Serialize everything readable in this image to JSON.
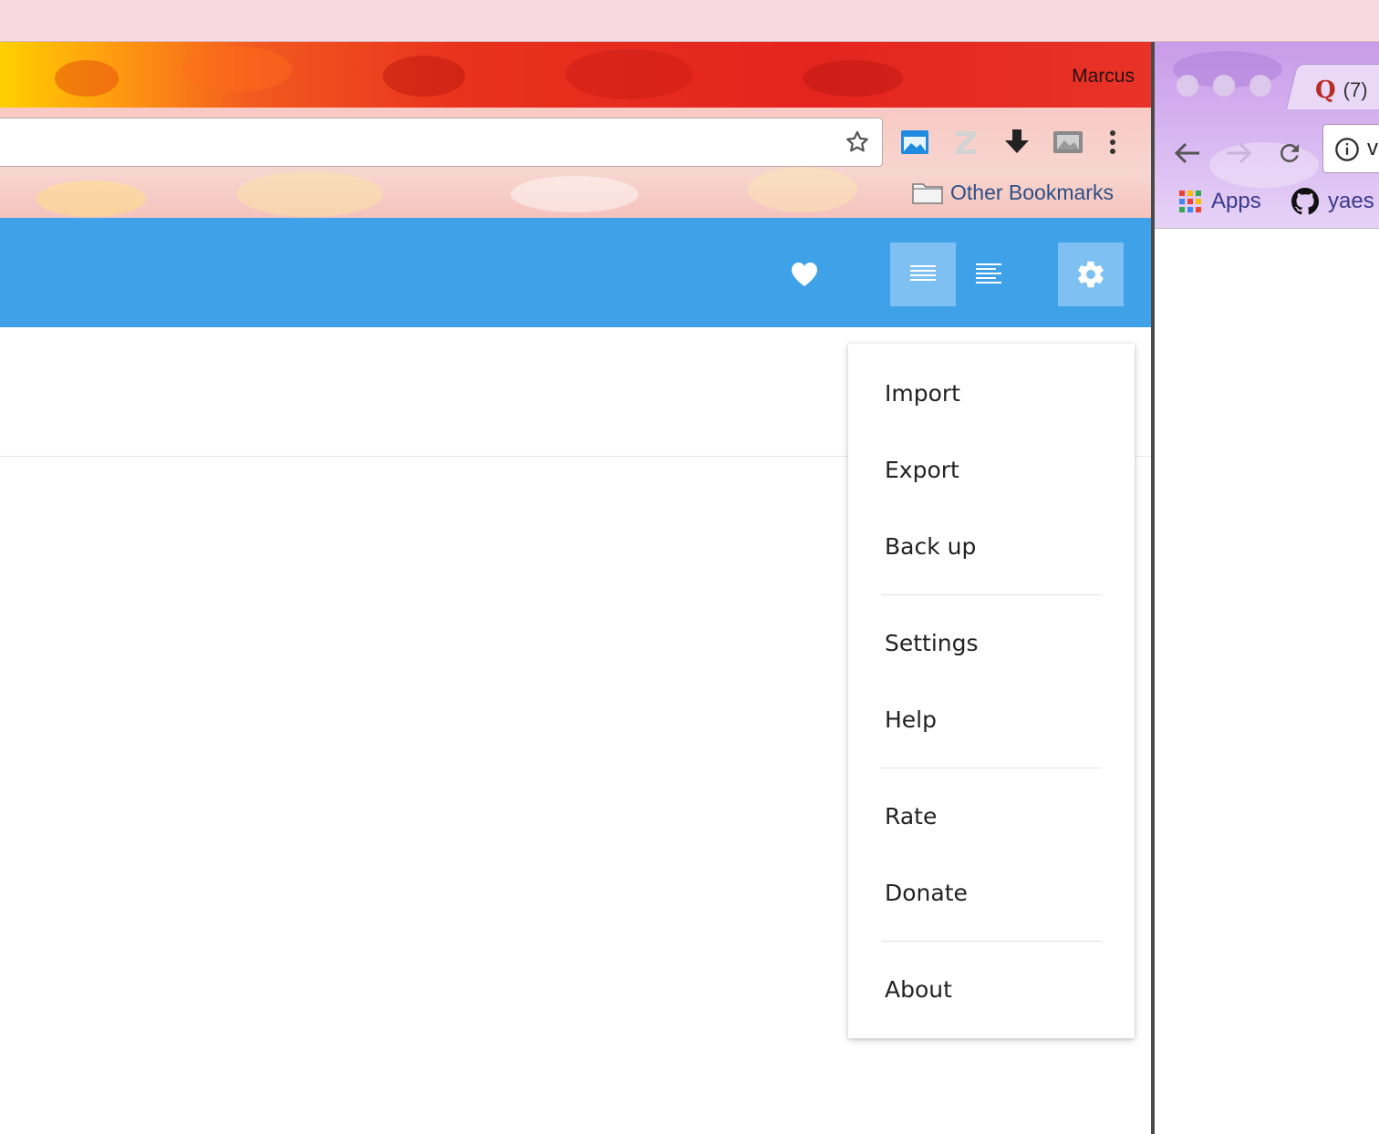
{
  "browser_left": {
    "profile_name": "Marcus",
    "bookmarks": [
      {
        "label": "Other Bookmarks",
        "icon": "folder-icon"
      }
    ],
    "extensions": [
      "extension-window-icon",
      "extension-z-icon",
      "download-icon",
      "extension-image-icon",
      "more-menu-icon"
    ]
  },
  "app": {
    "header_colors": {
      "bar": "#3fa2e9",
      "active_button": "#7fc0f2"
    },
    "header_buttons": [
      {
        "icon": "heart-icon"
      },
      {
        "icon": "justify-view-icon",
        "active": true
      },
      {
        "icon": "align-left-view-icon"
      },
      {
        "icon": "gear-icon",
        "active": true
      }
    ]
  },
  "menu": {
    "groups": [
      [
        "Import",
        "Export",
        "Back up"
      ],
      [
        "Settings",
        "Help"
      ],
      [
        "Rate",
        "Donate"
      ],
      [
        "About"
      ]
    ]
  },
  "browser_right": {
    "tab_title": "(7)",
    "tab_icon": "quora-icon",
    "address_partial": "v",
    "bookmarks": [
      {
        "label": "Apps",
        "icon": "apps-grid-icon"
      },
      {
        "label": "yaes",
        "icon": "github-icon"
      }
    ]
  }
}
